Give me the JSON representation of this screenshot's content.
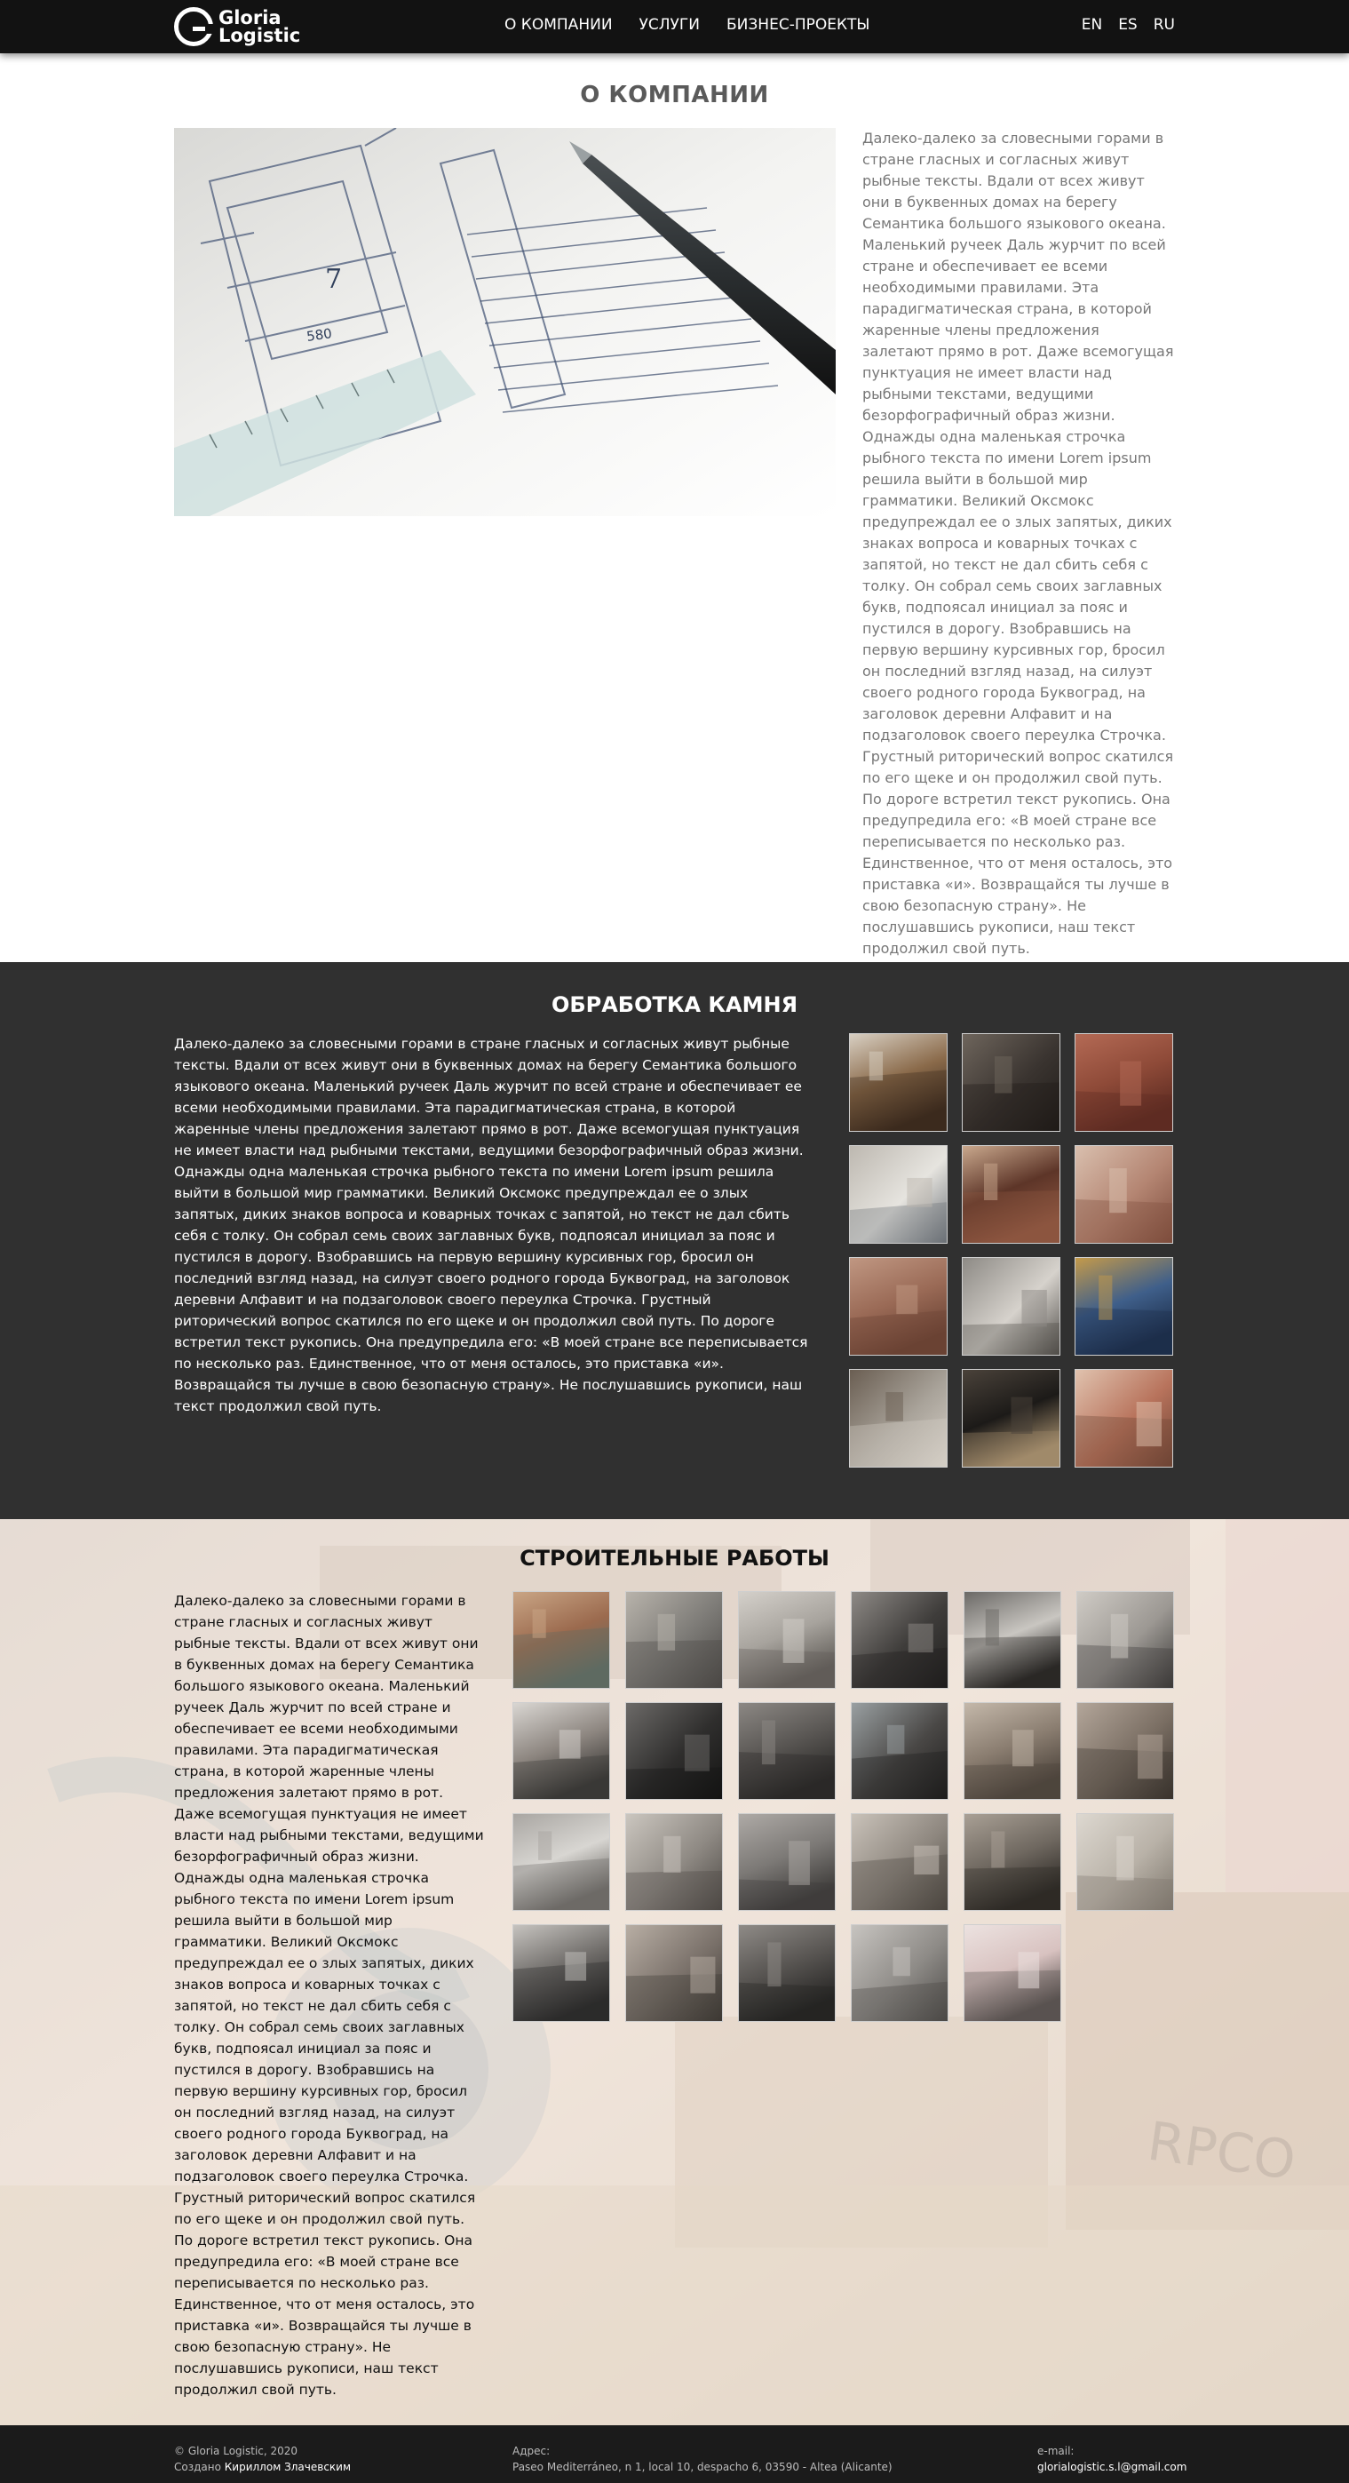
{
  "header": {
    "logo_line1": "Gloria",
    "logo_line2": "Logistic",
    "nav": [
      "О КОМПАНИИ",
      "УСЛУГИ",
      "БИЗНЕС-ПРОЕКТЫ"
    ],
    "languages": [
      "EN",
      "ES",
      "RU"
    ]
  },
  "about": {
    "title": "О КОМПАНИИ",
    "photo_icon": "blueprint-photo",
    "text": "Далеко-далеко за словесными горами в стране гласных и согласных живут рыбные тексты. Вдали от всех живут они в буквенных домах на берегу Семантика большого языкового океана. Маленький ручеек Даль журчит по всей стране и обеспечивает ее всеми необходимыми правилами. Эта парадигматическая страна, в которой жаренные члены предложения залетают прямо в рот. Даже всемогущая пунктуация не имеет власти над рыбными текстами, ведущими безорфографичный образ жизни. Однажды одна маленькая строчка рыбного текста по имени Lorem ipsum решила выйти в большой мир грамматики. Великий Оксмокс предупреждал ее о злых запятых, диких знаках вопроса и коварных точках с запятой, но текст не дал сбить себя с толку. Он собрал семь своих заглавных букв, подпоясал инициал за пояс и пустился в дорогу. Взобравшись на первую вершину курсивных гор, бросил он последний взгляд назад, на силуэт своего родного города Буквоград, на заголовок деревни Алфавит и на подзаголовок своего переулка Строчка. Грустный риторический вопрос скатился по его щеке и он продолжил свой путь. По дороге встретил текст рукопись. Она предупредила его: «В моей стране все переписывается по несколько раз. Единственное, что от меня осталось, это приставка «и». Возвращайся ты лучше в свою безопасную страну». Не послушавшись рукописи, наш текст продолжил свой путь."
  },
  "stone": {
    "title": "ОБРАБОТКА КАМНЯ",
    "text": "Далеко-далеко за словесными горами в стране гласных и согласных живут рыбные тексты. Вдали от всех живут они в буквенных домах на берегу Семантика большого языкового океана. Маленький ручеек Даль журчит по всей стране и обеспечивает ее всеми необходимыми правилами. Эта парадигматическая страна, в которой жаренные члены предложения залетают прямо в рот. Даже всемогущая пунктуация не имеет власти над рыбными текстами, ведущими безорфографичный образ жизни. Однажды одна маленькая строчка рыбного текста по имени Lorem ipsum решила выйти в большой мир грамматики. Великий Оксмокс предупреждал ее о злых запятых, диких знаков вопроса и коварных точках с запятой, но текст не дал сбить себя с толку. Он собрал семь своих заглавных букв, подпоясал инициал за пояс и пустился в дорогу. Взобравшись на первую вершину курсивных гор, бросил он последний взгляд назад, на силуэт своего родного города Буквоград, на заголовок деревни Алфавит и на подзаголовок своего переулка Строчка. Грустный риторический вопрос скатился по его щеке и он продолжил свой путь. По дороге встретил текст рукопись. Она предупредила его: «В моей стране все переписывается по несколько раз. Единственное, что от меня осталось, это приставка «и». Возвращайся ты лучше в свою безопасную страну». Не послушавшись рукописи, наш текст продолжил свой путь.",
    "gallery": [
      {
        "icon": "marble-medallion-photo",
        "colors": [
          "#8a6a4a",
          "#d8cfc2",
          "#3b2a1e"
        ]
      },
      {
        "icon": "dark-floor-photo",
        "colors": [
          "#3a3430",
          "#6e655c",
          "#1f1b18"
        ]
      },
      {
        "icon": "red-marble-floor-photo",
        "colors": [
          "#8e4a38",
          "#b46a55",
          "#5e2c22"
        ]
      },
      {
        "icon": "white-marble-stairs-photo",
        "colors": [
          "#e6e4df",
          "#bdb8b0",
          "#6b7076"
        ]
      },
      {
        "icon": "inlay-floor-photo",
        "colors": [
          "#5d3528",
          "#c9a88d",
          "#8c5540"
        ]
      },
      {
        "icon": "checker-floor-photo",
        "colors": [
          "#b48572",
          "#d9bfae",
          "#7d4c3c"
        ]
      },
      {
        "icon": "granite-floor-photo",
        "colors": [
          "#9a6a56",
          "#c09782",
          "#6b4334"
        ]
      },
      {
        "icon": "kitchen-interior-photo",
        "colors": [
          "#d6d2cc",
          "#8d8a85",
          "#4f4c48"
        ]
      },
      {
        "icon": "blue-gold-marble-photo",
        "colors": [
          "#3f5f8a",
          "#c49a4a",
          "#1d2e4a"
        ]
      },
      {
        "icon": "compass-rose-floor-photo",
        "colors": [
          "#a9a39a",
          "#6a5e52",
          "#d5cfc6"
        ]
      },
      {
        "icon": "black-tile-floor-photo",
        "colors": [
          "#1c1a18",
          "#4a423a",
          "#a08a6a"
        ]
      },
      {
        "icon": "mosaic-hall-photo",
        "colors": [
          "#b8735c",
          "#e0c2ae",
          "#6e4435"
        ]
      }
    ]
  },
  "construction": {
    "title": "СТРОИТЕЛЬНЫЕ РАБОТЫ",
    "text": "Далеко-далеко за словесными горами в стране гласных и согласных живут рыбные тексты. Вдали от всех живут они в буквенных домах на берегу Семантика большого языкового океана. Маленький ручеек Даль журчит по всей стране и обеспечивает ее всеми необходимыми правилами. Эта парадигматическая страна, в которой жаренные члены предложения залетают прямо в рот. Даже всемогущая пунктуация не имеет власти над рыбными текстами, ведущими безорфографичный образ жизни. Однажды одна маленькая строчка рыбного текста по имени Lorem ipsum решила выйти в большой мир грамматики. Великий Оксмокс предупреждал ее о злых запятых, диких знаков вопроса и коварных точках с запятой, но текст не дал сбить себя с толку. Он собрал семь своих заглавных букв, подпоясал инициал за пояс и пустился в дорогу. Взобравшись на первую вершину курсивных гор, бросил он последний взгляд назад, на силуэт своего родного города Буквоград, на заголовок деревни Алфавит и на подзаголовок своего переулка Строчка. Грустный риторический вопрос скатился по его щеке и он продолжил свой путь. По дороге встретил текст рукопись. Она предупредила его: «В моей стране все переписывается по несколько раз. Единственное, что от меня осталось, это приставка «и». Возвращайся ты лучше в свою безопасную страну». Не послушавшись рукописи, наш текст продолжил свой путь.",
    "background_icon": "construction-site-background",
    "gallery": [
      {
        "icon": "brick-wall-worker-photo",
        "colors": [
          "#9b6a4e",
          "#c9a585",
          "#5e6b62"
        ]
      },
      {
        "icon": "plastering-photo",
        "colors": [
          "#7c7a76",
          "#b8b3ab",
          "#4a4744"
        ]
      },
      {
        "icon": "corridor-renovation-photo",
        "colors": [
          "#a7a39d",
          "#d4d0ca",
          "#615d58"
        ]
      },
      {
        "icon": "worker-dark-room-photo",
        "colors": [
          "#3f3d3b",
          "#8e8a86",
          "#1f1e1d"
        ]
      },
      {
        "icon": "finished-room-door-photo",
        "colors": [
          "#c9c6c1",
          "#6b6966",
          "#2a2826"
        ]
      },
      {
        "icon": "bare-room-photo",
        "colors": [
          "#9c9893",
          "#cfcbc5",
          "#3c3a38"
        ]
      },
      {
        "icon": "worker-ladder-photo",
        "colors": [
          "#8d8680",
          "#d9d6d2",
          "#3a3836"
        ]
      },
      {
        "icon": "dark-doorway-photo",
        "colors": [
          "#2f2e2d",
          "#6c6a68",
          "#141413"
        ]
      },
      {
        "icon": "block-wall-photo",
        "colors": [
          "#585552",
          "#8c8884",
          "#2a2927"
        ]
      },
      {
        "icon": "window-room-photo",
        "colors": [
          "#4a4846",
          "#9aa0a2",
          "#1e1d1c"
        ]
      },
      {
        "icon": "floor-debris-photo",
        "colors": [
          "#8a7d70",
          "#c4b8aa",
          "#4e453d"
        ]
      },
      {
        "icon": "worker-floor-photo",
        "colors": [
          "#7a6e63",
          "#b3a69a",
          "#3a332d"
        ]
      },
      {
        "icon": "white-room-photo",
        "colors": [
          "#d8d6d2",
          "#a9a6a2",
          "#6d6a66"
        ]
      },
      {
        "icon": "worker-sanding-photo",
        "colors": [
          "#8f8a84",
          "#cbc6bf",
          "#4d4944"
        ]
      },
      {
        "icon": "gray-room-photo",
        "colors": [
          "#7c7976",
          "#aeaaa6",
          "#3f3d3b"
        ]
      },
      {
        "icon": "worker-corridor-photo",
        "colors": [
          "#8e877f",
          "#c9c2b9",
          "#4b463f"
        ]
      },
      {
        "icon": "worker-mask-photo",
        "colors": [
          "#6f6860",
          "#a9a095",
          "#2e2a26"
        ]
      },
      {
        "icon": "plaster-wall-photo",
        "colors": [
          "#b9b2a8",
          "#ddd8d0",
          "#7d766c"
        ]
      },
      {
        "icon": "worker-window-photo",
        "colors": [
          "#6e6b68",
          "#c6c3bf",
          "#2c2b2a"
        ]
      },
      {
        "icon": "interior-view-photo",
        "colors": [
          "#7a716a",
          "#b8aea4",
          "#3d3833"
        ]
      },
      {
        "icon": "doorway-room-photo",
        "colors": [
          "#565350",
          "#8f8b87",
          "#252423"
        ]
      },
      {
        "icon": "balcony-room-photo",
        "colors": [
          "#8e8b87",
          "#c7c4c0",
          "#4b4946"
        ]
      },
      {
        "icon": "pink-room-photo",
        "colors": [
          "#d8c2c0",
          "#ece2e0",
          "#5a5250"
        ]
      }
    ]
  },
  "footer": {
    "copyright": "© Gloria Logistic, 2020",
    "created_label": "Создано",
    "created_by": "Кириллом Злачевским",
    "address_label": "Адрес:",
    "address": "Paseo Mediterráneo, n 1, local 10, despacho 6, 03590 - Altea (Alicante)",
    "email_label": "e-mail:",
    "email": "glorialogistic.s.l@gmail.com"
  }
}
